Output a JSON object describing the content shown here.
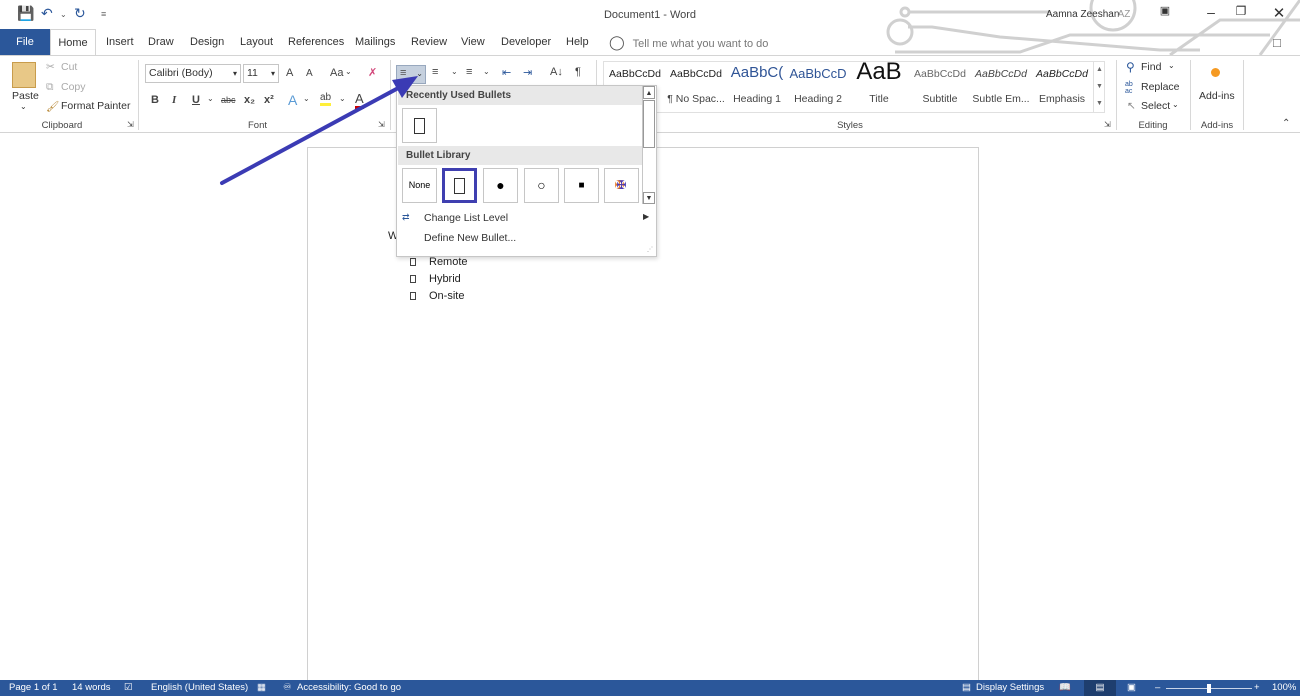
{
  "window": {
    "title": "Document1  -  Word",
    "user_name": "Aamna Zeeshan",
    "user_initials": "AZ"
  },
  "qat": {
    "save": "save-icon",
    "undo": "undo-icon",
    "redo": "redo-icon",
    "customize": "customize-icon"
  },
  "tabs": [
    "File",
    "Home",
    "Insert",
    "Draw",
    "Design",
    "Layout",
    "References",
    "Mailings",
    "Review",
    "View",
    "Developer",
    "Help"
  ],
  "tell_me": {
    "placeholder": "Tell me what you want to do"
  },
  "clipboard": {
    "paste": "Paste",
    "cut": "Cut",
    "copy": "Copy",
    "format_painter": "Format Painter",
    "label": "Clipboard"
  },
  "font": {
    "name": "Calibri (Body)",
    "size": "11",
    "label": "Font",
    "bold": "B",
    "italic": "I",
    "underline": "U",
    "strike": "abc",
    "sub": "x₂",
    "sup": "x²",
    "case": "Aa",
    "grow": "A",
    "shrink": "A"
  },
  "paragraph": {
    "sort": "A↓",
    "pilcrow": "¶"
  },
  "styles": {
    "label": "Styles",
    "items": [
      {
        "preview": "AaBbCcDd",
        "name": ""
      },
      {
        "preview": "AaBbCcDd",
        "name": "¶ No Spac..."
      },
      {
        "preview": "AaBbC(",
        "name": "Heading 1"
      },
      {
        "preview": "AaBbCcD",
        "name": "Heading 2"
      },
      {
        "preview": "AaB",
        "name": "Title"
      },
      {
        "preview": "AaBbCcDd",
        "name": "Subtitle"
      },
      {
        "preview": "AaBbCcDd",
        "name": "Subtle Em..."
      },
      {
        "preview": "AaBbCcDd",
        "name": "Emphasis"
      }
    ]
  },
  "editing": {
    "find": "Find",
    "replace": "Replace",
    "select": "Select",
    "label": "Editing"
  },
  "addins": {
    "button": "Add-ins",
    "label": "Add-ins"
  },
  "bullet_dropdown": {
    "recent_header": "Recently Used Bullets",
    "library_header": "Bullet Library",
    "none_label": "None",
    "library": [
      "none",
      "empty-box",
      "filled-circle",
      "hollow-circle",
      "filled-square",
      "arrowhead"
    ],
    "selected_index": 1,
    "change_level": "Change List Level",
    "define_new": "Define New Bullet..."
  },
  "document": {
    "heading_fragment": "W",
    "list": [
      "Remote",
      "Hybrid",
      "On-site"
    ]
  },
  "status": {
    "page": "Page 1 of 1",
    "words": "14 words",
    "language": "English (United States)",
    "accessibility": "Accessibility: Good to go",
    "display_settings": "Display Settings",
    "zoom": "100%",
    "zoom_percent": 100
  },
  "colors": {
    "accent": "#2b579a",
    "arrow": "#3b3bb4",
    "selected_bullet_border": "#3f3fb0"
  }
}
